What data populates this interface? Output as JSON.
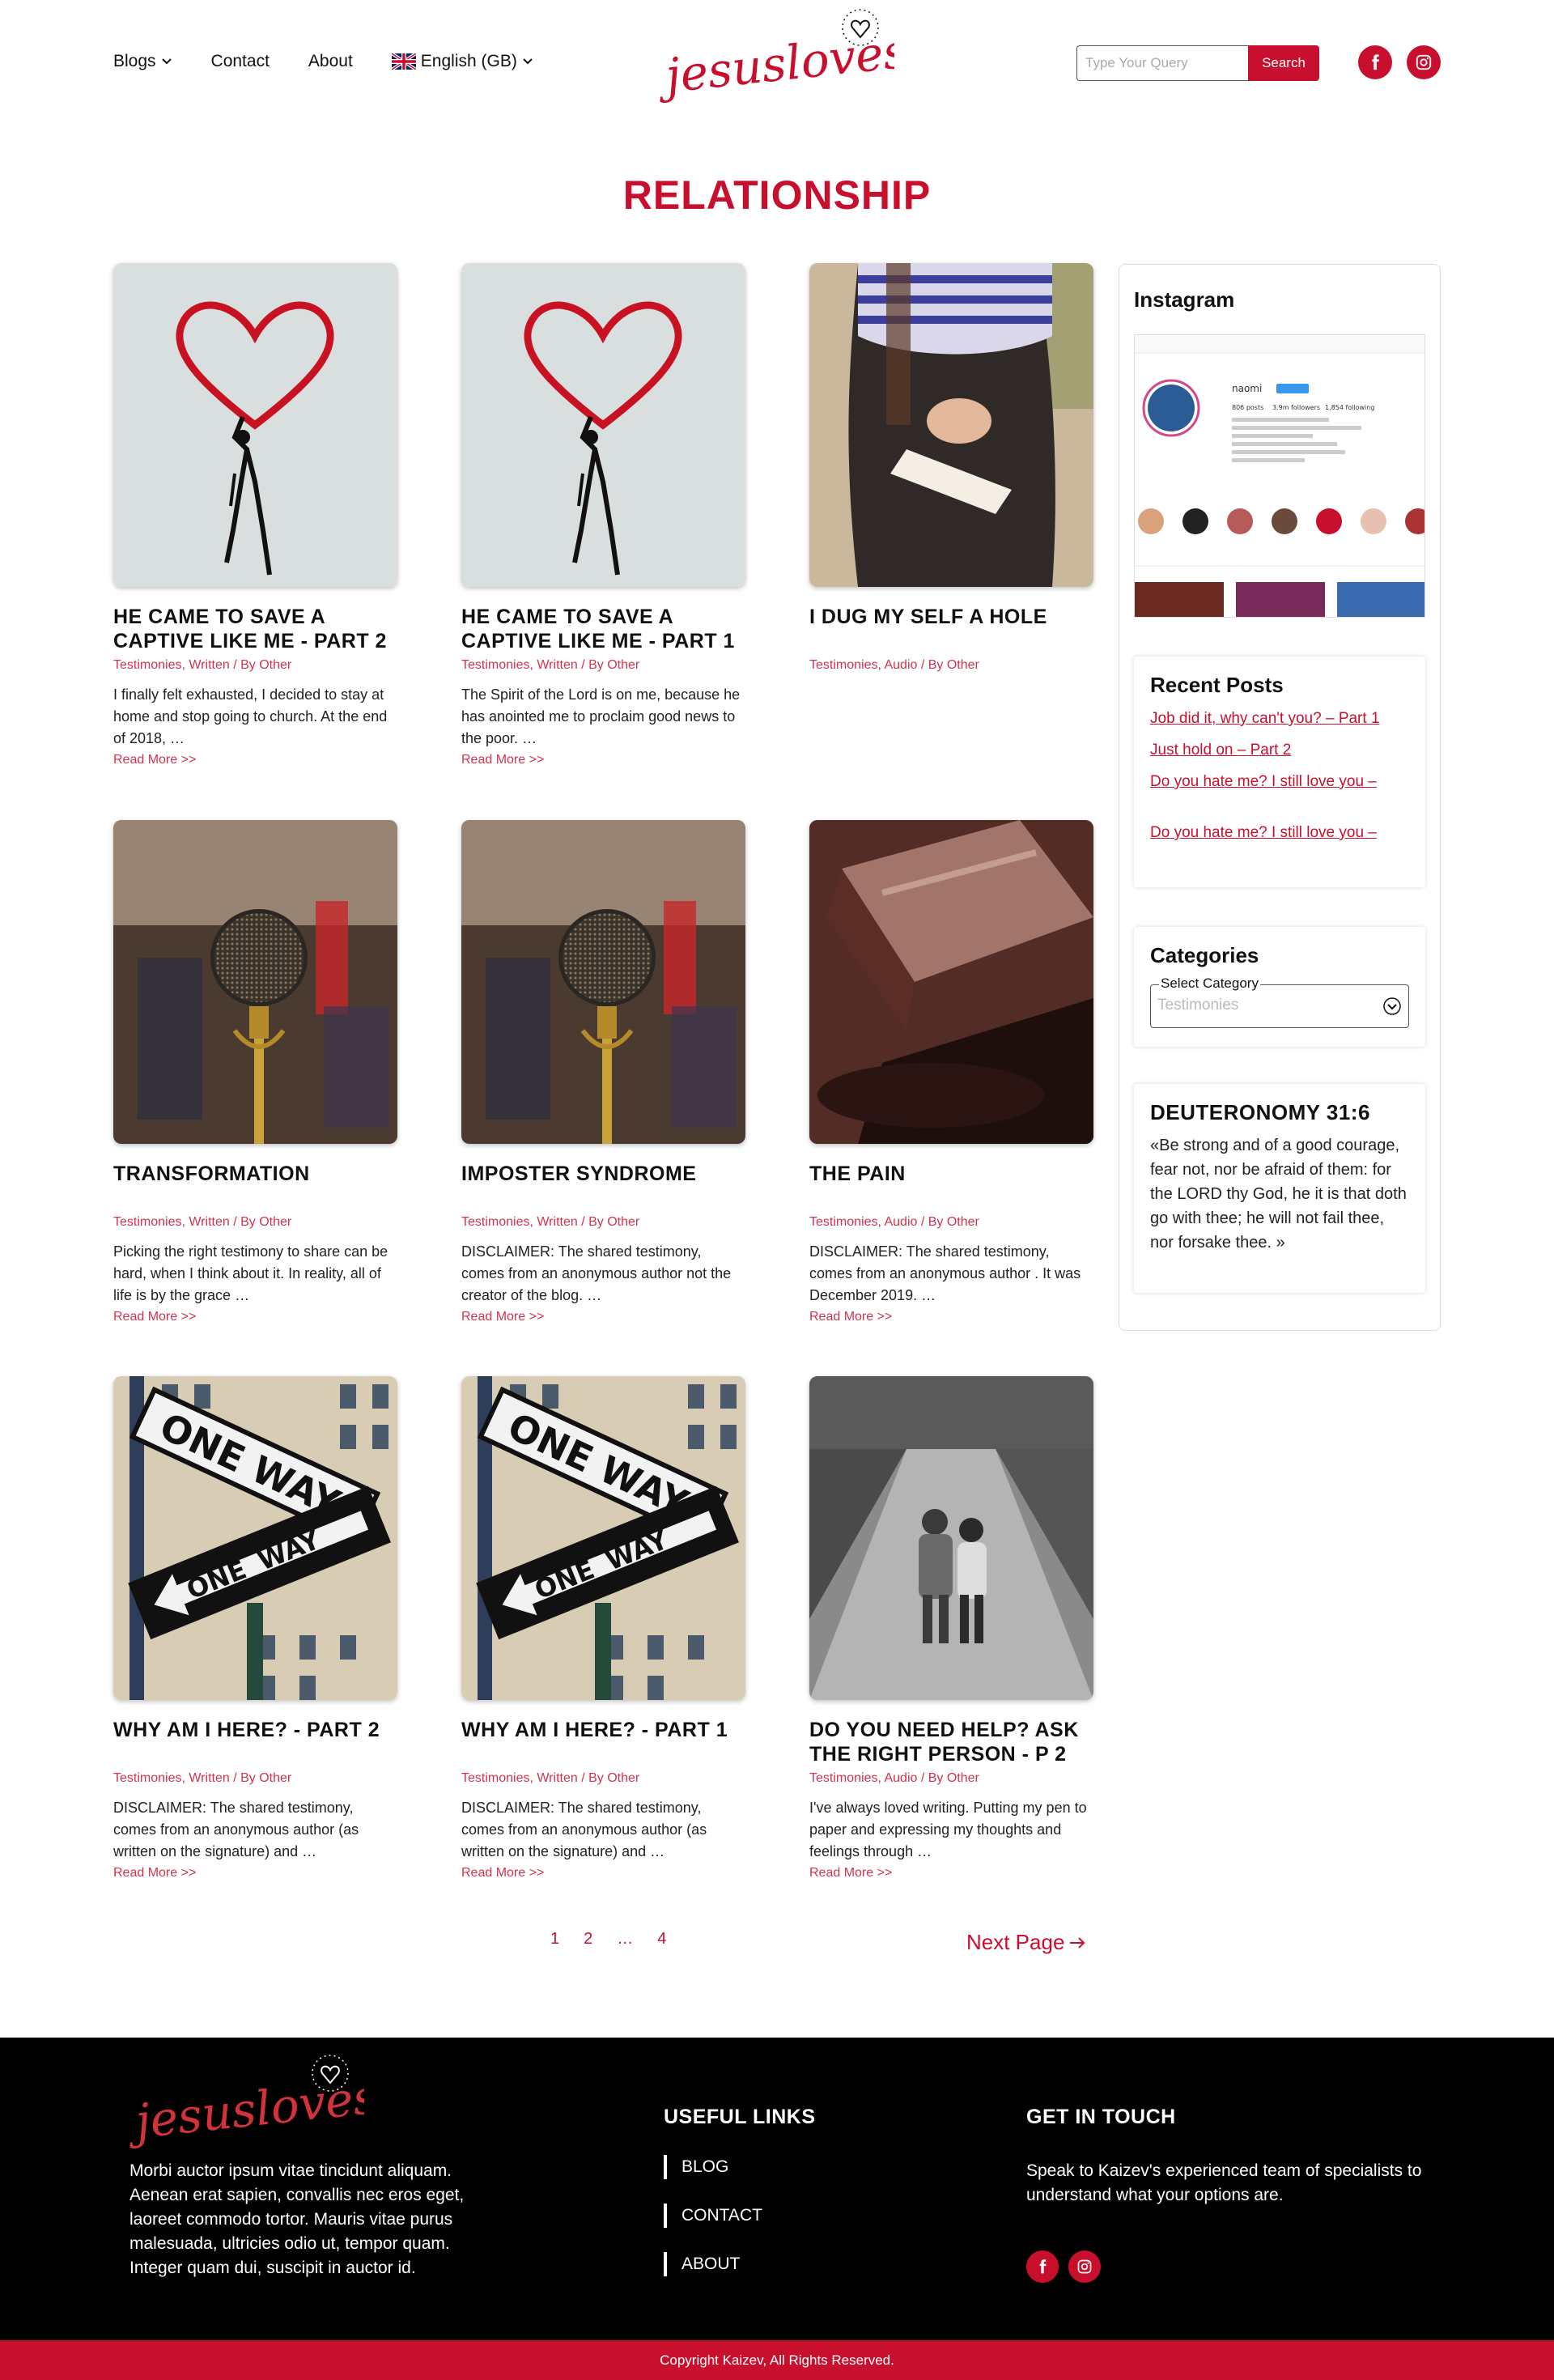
{
  "header": {
    "nav": [
      {
        "label": "Blogs",
        "dropdown": true
      },
      {
        "label": "Contact"
      },
      {
        "label": "About"
      },
      {
        "label": "English (GB)",
        "dropdown": true,
        "flag": "uk-flag-icon"
      }
    ],
    "logo_text": "jesuslovesyou",
    "search": {
      "placeholder": "Type Your Query",
      "button": "Search"
    },
    "social": [
      "facebook-icon",
      "instagram-icon"
    ]
  },
  "page_title": "RELATIONSHIP",
  "posts": [
    {
      "title": "HE CAME TO SAVE A CAPTIVE LIKE ME - PART 2",
      "meta": "Testimonies, Written / By Other",
      "excerpt": "I finally felt exhausted, I decided to stay at home and stop going to church. At the end of 2018, …",
      "more": "Read More >>",
      "image": "heart-graffiti"
    },
    {
      "title": "HE CAME TO SAVE A CAPTIVE LIKE ME - PART 1",
      "meta": "Testimonies, Written / By Other",
      "excerpt": "The Spirit of the Lord is on me, because he has anointed me to proclaim good news to the poor. …",
      "more": "Read More >>",
      "image": "heart-graffiti"
    },
    {
      "title": "I DUG MY SELF A HOLE",
      "meta": "Testimonies, Audio / By Other",
      "excerpt": "",
      "more": "",
      "image": "praying-hands"
    },
    {
      "title": "TRANSFORMATION",
      "meta": "Testimonies, Written / By Other",
      "excerpt": "Picking the right testimony to share can be hard, when I think about it. In reality, all of life is by the grace …",
      "more": "Read More >>",
      "image": "microphone"
    },
    {
      "title": "IMPOSTER SYNDROME",
      "meta": "Testimonies, Written / By Other",
      "excerpt": "DISCLAIMER: The shared testimony, comes from an anonymous author not the creator of the blog. …",
      "more": "Read More >>",
      "image": "microphone"
    },
    {
      "title": "THE PAIN",
      "meta": "Testimonies, Audio / By Other",
      "excerpt": "DISCLAIMER: The shared testimony, comes from an anonymous author . It was December 2019. …",
      "more": "Read More >>",
      "image": "gavel"
    },
    {
      "title": "WHY AM I HERE? - PART 2",
      "meta": "Testimonies, Written / By Other",
      "excerpt": "DISCLAIMER: The shared testimony, comes from an anonymous author (as written on the signature) and …",
      "more": "Read More >>",
      "image": "one-way"
    },
    {
      "title": "WHY AM I HERE? - PART 1",
      "meta": "Testimonies, Written / By Other",
      "excerpt": "DISCLAIMER: The shared testimony, comes from an anonymous author (as written on the signature) and …",
      "more": "Read More >>",
      "image": "one-way"
    },
    {
      "title": "DO YOU NEED HELP? ASK THE RIGHT PERSON - P 2",
      "meta": "Testimonies, Audio / By Other",
      "excerpt": "I've always loved writing. Putting my pen to paper and expressing my thoughts and feelings through …",
      "more": "Read More >>",
      "image": "children-walking"
    }
  ],
  "pagination": {
    "pages": [
      "1",
      "2",
      "…",
      "4"
    ],
    "next": "Next Page"
  },
  "sidebar": {
    "instagram_title": "Instagram",
    "instagram_profile": {
      "name": "naomi",
      "stats": [
        "806 posts",
        "3.9m followers",
        "1,854 following"
      ]
    },
    "recent_title": "Recent Posts",
    "recent": [
      "Job did it, why can't you? – Part 1",
      "Just hold on – Part 2",
      "Do you hate me? I still love you –",
      "Do you hate me? I still love you –"
    ],
    "categories_title": "Categories",
    "category_label": "Select Category",
    "category_value": "Testimonies",
    "verse_title": "DEUTERONOMY 31:6",
    "verse_text": "«Be strong and of a good courage, fear not, nor be afraid of them: for the LORD thy God, he it is that doth go with thee; he will not fail thee, nor forsake thee. »"
  },
  "footer": {
    "about": "Morbi auctor ipsum vitae tincidunt aliquam. Aenean erat sapien, convallis nec eros eget, laoreet commodo tortor. Mauris vitae purus malesuada, ultricies odio ut, tempor quam. Integer quam dui, suscipit in auctor id.",
    "links_title": "USEFUL LINKS",
    "links": [
      "BLOG",
      "CONTACT",
      "ABOUT"
    ],
    "touch_title": "GET IN TOUCH",
    "touch_text": "Speak to Kaizev's experienced team of specialists to understand what your options are.",
    "copyright": "Copyright Kaizev, All Rights Reserved."
  },
  "colors": {
    "accent": "#c8102e",
    "footer_bg": "#000000"
  }
}
